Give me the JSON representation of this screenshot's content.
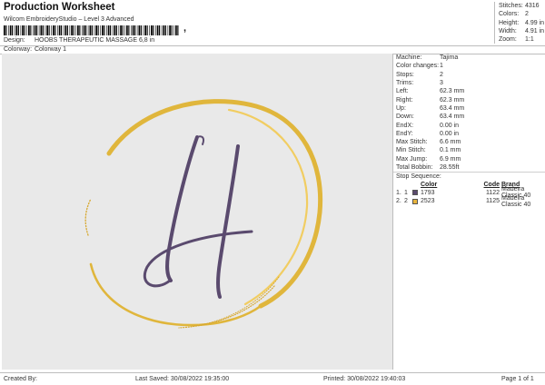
{
  "header": {
    "title": "Production Worksheet",
    "software": "Wilcom EmbroideryStudio – Level 3 Advanced",
    "barcode_suffix": ","
  },
  "design": {
    "design_label": "Design:",
    "design_value": "HOOBS THERAPEUTIC MASSAGE 6,8 in",
    "colorway_label": "Colorway:",
    "colorway_value": "Colorway 1"
  },
  "stats": [
    {
      "label": "Stitches:",
      "value": "4316"
    },
    {
      "label": "Colors:",
      "value": "2"
    },
    {
      "label": "Height:",
      "value": "4.99 in"
    },
    {
      "label": "Width:",
      "value": "4.91 in"
    },
    {
      "label": "Zoom:",
      "value": "1:1"
    }
  ],
  "machine_info": [
    {
      "label": "Machine:",
      "value": "Tajima"
    },
    {
      "label": "Color changes:",
      "value": "1"
    },
    {
      "label": "Stops:",
      "value": "2"
    },
    {
      "label": "Trims:",
      "value": "3"
    },
    {
      "label": "Left:",
      "value": "62.3 mm"
    },
    {
      "label": "Right:",
      "value": "62.3 mm"
    },
    {
      "label": "Up:",
      "value": "63.4 mm"
    },
    {
      "label": "Down:",
      "value": "63.4 mm"
    },
    {
      "label": "EndX:",
      "value": "0.00 in"
    },
    {
      "label": "EndY:",
      "value": "0.00 in"
    },
    {
      "label": "Max Stitch:",
      "value": "6.6 mm"
    },
    {
      "label": "Min Stitch:",
      "value": "0.1 mm"
    },
    {
      "label": "Max Jump:",
      "value": "6.9 mm"
    },
    {
      "label": "Total Bobbin:",
      "value": "28.55ft"
    }
  ],
  "stop_sequence": {
    "label": "Stop Sequence:",
    "columns": {
      "n": "",
      "c": "",
      "color": "Color",
      "code": "Code",
      "brand": "Brand"
    },
    "rows": [
      {
        "n": "1.",
        "c": "1",
        "swatch": "#5a4a6e",
        "color": "1793",
        "code": "1122",
        "brand": "Madeira Classic 40"
      },
      {
        "n": "2.",
        "c": "2",
        "swatch": "#e8b43c",
        "color": "2523",
        "code": "1125",
        "brand": "Madeira Classic 40"
      }
    ]
  },
  "footer": {
    "created_by": "Created By:",
    "last_saved": "Last Saved: 30/08/2022 19:35:00",
    "printed": "Printed: 30/08/2022 19:40:03",
    "page": "Page 1 of 1"
  },
  "colors": {
    "purple_thread": "#5a4a6e",
    "gold_thread": "#e0b63c",
    "canvas_bg": "#e9e9e9"
  }
}
